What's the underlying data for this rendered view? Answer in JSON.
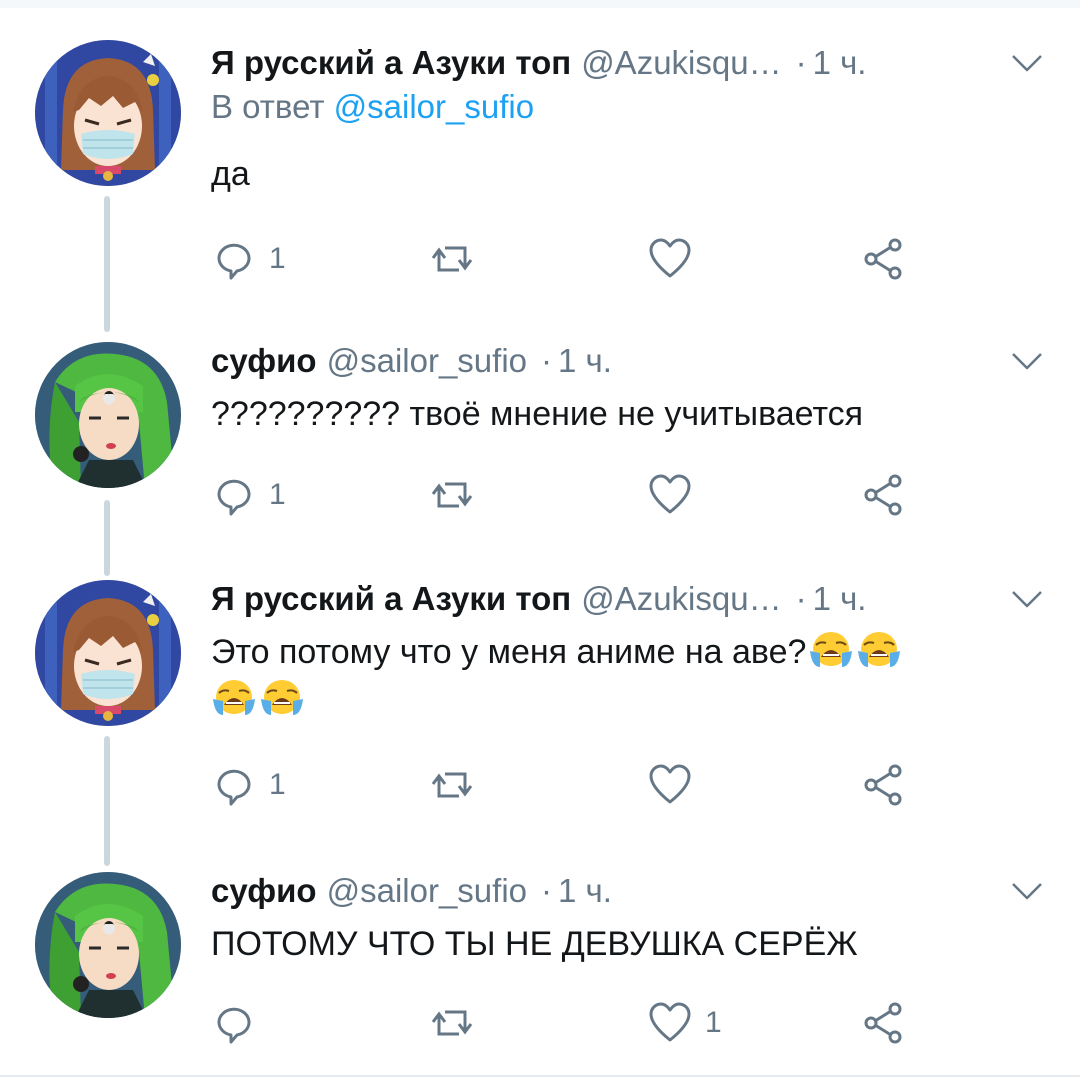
{
  "colors": {
    "accent": "#1da1f2",
    "muted": "#657786",
    "line": "#ccd6dd"
  },
  "tweets": [
    {
      "name": "Я русский а Азуки топ",
      "handle": "@Azukisqu…",
      "dot": "·",
      "time": "1 ч.",
      "reply_prefix": "В ответ",
      "reply_mention": "@sailor_sufio",
      "text": "да",
      "reply_count": "1",
      "retweet_count": "",
      "like_count": "",
      "avatar": "girl-mask-avatar"
    },
    {
      "name": "суфио",
      "handle": "@sailor_sufio",
      "dot": "·",
      "time": "1 ч.",
      "text": "?????????? твоё мнение не учитывается",
      "reply_count": "1",
      "retweet_count": "",
      "like_count": "",
      "avatar": "green-hair-avatar"
    },
    {
      "name": "Я русский а Азуки топ",
      "handle": "@Azukisqu…",
      "dot": "·",
      "time": "1 ч.",
      "text": "Это потому что у меня аниме на аве?",
      "emoji": "loudly-crying-face",
      "reply_count": "1",
      "retweet_count": "",
      "like_count": "",
      "avatar": "girl-mask-avatar"
    },
    {
      "name": "суфио",
      "handle": "@sailor_sufio",
      "dot": "·",
      "time": "1 ч.",
      "text": "ПОТОМУ ЧТО ТЫ НЕ ДЕВУШКА СЕРЁЖ",
      "reply_count": "",
      "retweet_count": "",
      "like_count": "1",
      "avatar": "green-hair-avatar"
    }
  ]
}
